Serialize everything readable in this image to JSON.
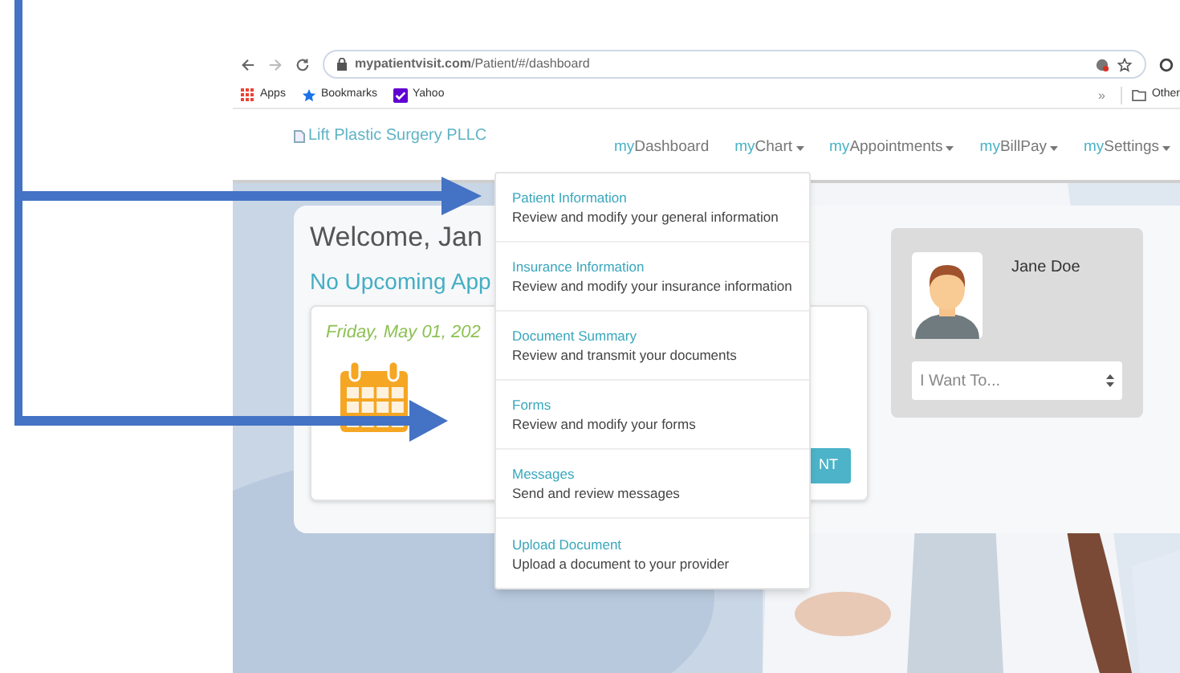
{
  "browser": {
    "url": "**mypatientvisit.com**/Patient/#/dashboard",
    "bookmarks": [
      {
        "label": "Apps",
        "kind": "apps"
      },
      {
        "label": "Bookmarks",
        "kind": "star"
      },
      {
        "label": "Yahoo",
        "kind": "yahoo"
      }
    ],
    "overflow": "»",
    "other_bookmarks": "Other"
  },
  "header": {
    "logo_alt": "Lift Plastic Surgery PLLC",
    "nav": [
      {
        "prefix": "my",
        "label": "Dashboard",
        "dropdown": false
      },
      {
        "prefix": "my",
        "label": "Chart",
        "dropdown": true
      },
      {
        "prefix": "my",
        "label": "Appointments",
        "dropdown": true
      },
      {
        "prefix": "my",
        "label": "BillPay",
        "dropdown": true
      },
      {
        "prefix": "my",
        "label": "Settings",
        "dropdown": true
      }
    ]
  },
  "welcome": {
    "greeting": "Welcome, Jan",
    "upcoming": "No Upcoming App",
    "date": "Friday, May 01, 202",
    "button": "NT"
  },
  "profile": {
    "name": "Jane Doe",
    "select_placeholder": "I Want To..."
  },
  "menu": [
    {
      "title": "Patient Information",
      "description": "Review and modify your general information"
    },
    {
      "title": "Insurance Information",
      "description": "Review and modify your insurance information"
    },
    {
      "title": "Document Summary",
      "description": "Review and transmit your documents"
    },
    {
      "title": "Forms",
      "description": "Review and modify your forms"
    },
    {
      "title": "Messages",
      "description": "Send and review messages"
    },
    {
      "title": "Upload Document",
      "description": "Upload a document to your provider"
    }
  ]
}
